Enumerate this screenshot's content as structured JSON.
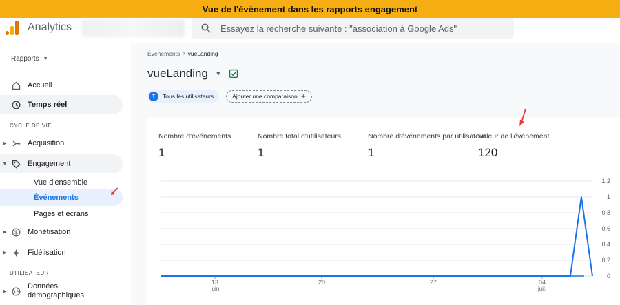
{
  "banner": {
    "text": "Vue de l'évènement dans les rapports engagement"
  },
  "topbar": {
    "app_name": "Analytics",
    "search_placeholder": "Essayez la recherche suivante : \"association à Google Ads\""
  },
  "sidebar": {
    "rapports_label": "Rapports",
    "items": [
      {
        "label": "Accueil",
        "icon": "home-icon"
      },
      {
        "label": "Temps réel",
        "icon": "clock-icon"
      }
    ],
    "section_cycle": "CYCLE DE VIE",
    "cycle_items": [
      {
        "label": "Acquisition",
        "icon": "acquisition-icon"
      },
      {
        "label": "Engagement",
        "icon": "tag-icon"
      }
    ],
    "engagement_sub": [
      {
        "label": "Vue d'ensemble"
      },
      {
        "label": "Événements"
      },
      {
        "label": "Pages et écrans"
      }
    ],
    "cycle_items2": [
      {
        "label": "Monétisation",
        "icon": "dollar-icon"
      },
      {
        "label": "Fidélisation",
        "icon": "retention-icon"
      }
    ],
    "section_user": "UTILISATEUR",
    "user_items": [
      {
        "label_line1": "Données",
        "label_line2": "démographiques",
        "icon": "globe-icon"
      }
    ]
  },
  "main": {
    "breadcrumb": {
      "parent": "Événements",
      "current": "vueLanding"
    },
    "title": "vueLanding",
    "chip_user": {
      "avatar": "T",
      "label": "Tous les utilisateurs"
    },
    "chip_add": "Ajouter une comparaison",
    "metrics": [
      {
        "label": "Nombre d'événements",
        "value": "1"
      },
      {
        "label": "Nombre total d'utilisateurs",
        "value": "1"
      },
      {
        "label": "Nombre d'événements par utilisateur",
        "value": "1"
      },
      {
        "label": "Valeur de l'événement",
        "value": "120"
      }
    ]
  },
  "colors": {
    "accent": "#1a73e8",
    "banner": "#f6ae12",
    "arrow": "#e53935",
    "line": "#1a73e8"
  },
  "chart_data": {
    "type": "line",
    "x_tick_labels": [
      {
        "day": "13",
        "month": "juin"
      },
      {
        "day": "20",
        "month": ""
      },
      {
        "day": "27",
        "month": ""
      },
      {
        "day": "04",
        "month": "juil."
      }
    ],
    "y_tick_labels": [
      "1,2",
      "1",
      "0,8",
      "0,6",
      "0,4",
      "0,2",
      "0"
    ],
    "ylim": [
      0,
      1.2
    ],
    "series": [
      {
        "values": [
          0,
          0,
          0,
          0,
          0,
          0,
          0,
          0,
          0,
          0,
          0,
          0,
          0,
          0,
          0,
          0,
          0,
          0,
          0,
          0,
          0,
          0,
          0,
          0,
          0,
          0,
          0,
          0,
          0,
          0,
          0,
          0,
          0,
          0,
          0,
          0,
          0,
          0,
          1,
          0
        ]
      }
    ]
  }
}
